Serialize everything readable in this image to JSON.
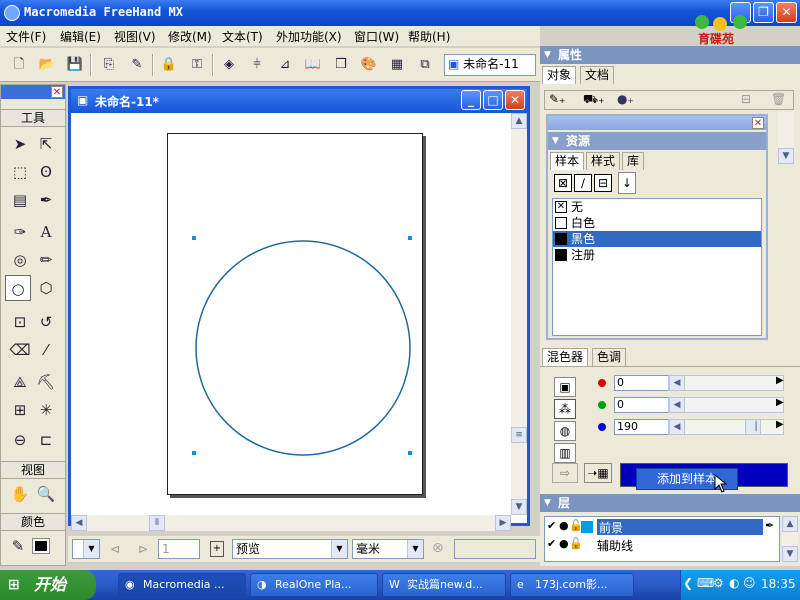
{
  "app": {
    "title": "Macromedia FreeHand MX"
  },
  "menu": [
    "文件(F)",
    "编辑(E)",
    "视图(V)",
    "修改(M)",
    "文本(T)",
    "外加功能(X)",
    "窗口(W)",
    "帮助(H)"
  ],
  "toolbar": {
    "doc_select": "未命名-11"
  },
  "logo": {
    "text": "育碟苑"
  },
  "tools_panel": {
    "title": "工具",
    "view_label": "视图",
    "color_label": "颜色"
  },
  "document": {
    "title": "未命名-11*"
  },
  "statusbar": {
    "page_value": "1",
    "view_mode": "预览",
    "units": "毫米"
  },
  "properties": {
    "title": "属性",
    "tabs": [
      "对象",
      "文档"
    ]
  },
  "assets": {
    "title": "资源",
    "tabs": [
      "样本",
      "样式",
      "库"
    ],
    "swatches": [
      {
        "name": "无",
        "color": "none"
      },
      {
        "name": "白色",
        "color": "#ffffff"
      },
      {
        "name": "黑色",
        "color": "#000000"
      },
      {
        "name": "注册",
        "color": "#000000"
      }
    ],
    "selected_index": 2
  },
  "mixer": {
    "tabs": [
      "混色器",
      "色调"
    ],
    "values": [
      {
        "channel": "red",
        "value": "0",
        "color": "#e00000"
      },
      {
        "channel": "green",
        "value": "0",
        "color": "#00a000"
      },
      {
        "channel": "blue",
        "value": "190",
        "color": "#0000e0"
      }
    ],
    "preview_color": "#0000be",
    "add_tooltip": "添加到样本"
  },
  "layers": {
    "title": "层",
    "items": [
      {
        "name": "前景",
        "color": "#00a0e0",
        "selected": true
      },
      {
        "name": "辅助线",
        "color": "",
        "selected": false
      }
    ]
  },
  "taskbar": {
    "start": "开始",
    "tasks": [
      "Macromedia ...",
      "RealOne Pla...",
      "实战篇new.d...",
      "173j.com影..."
    ],
    "clock": "18:35"
  }
}
